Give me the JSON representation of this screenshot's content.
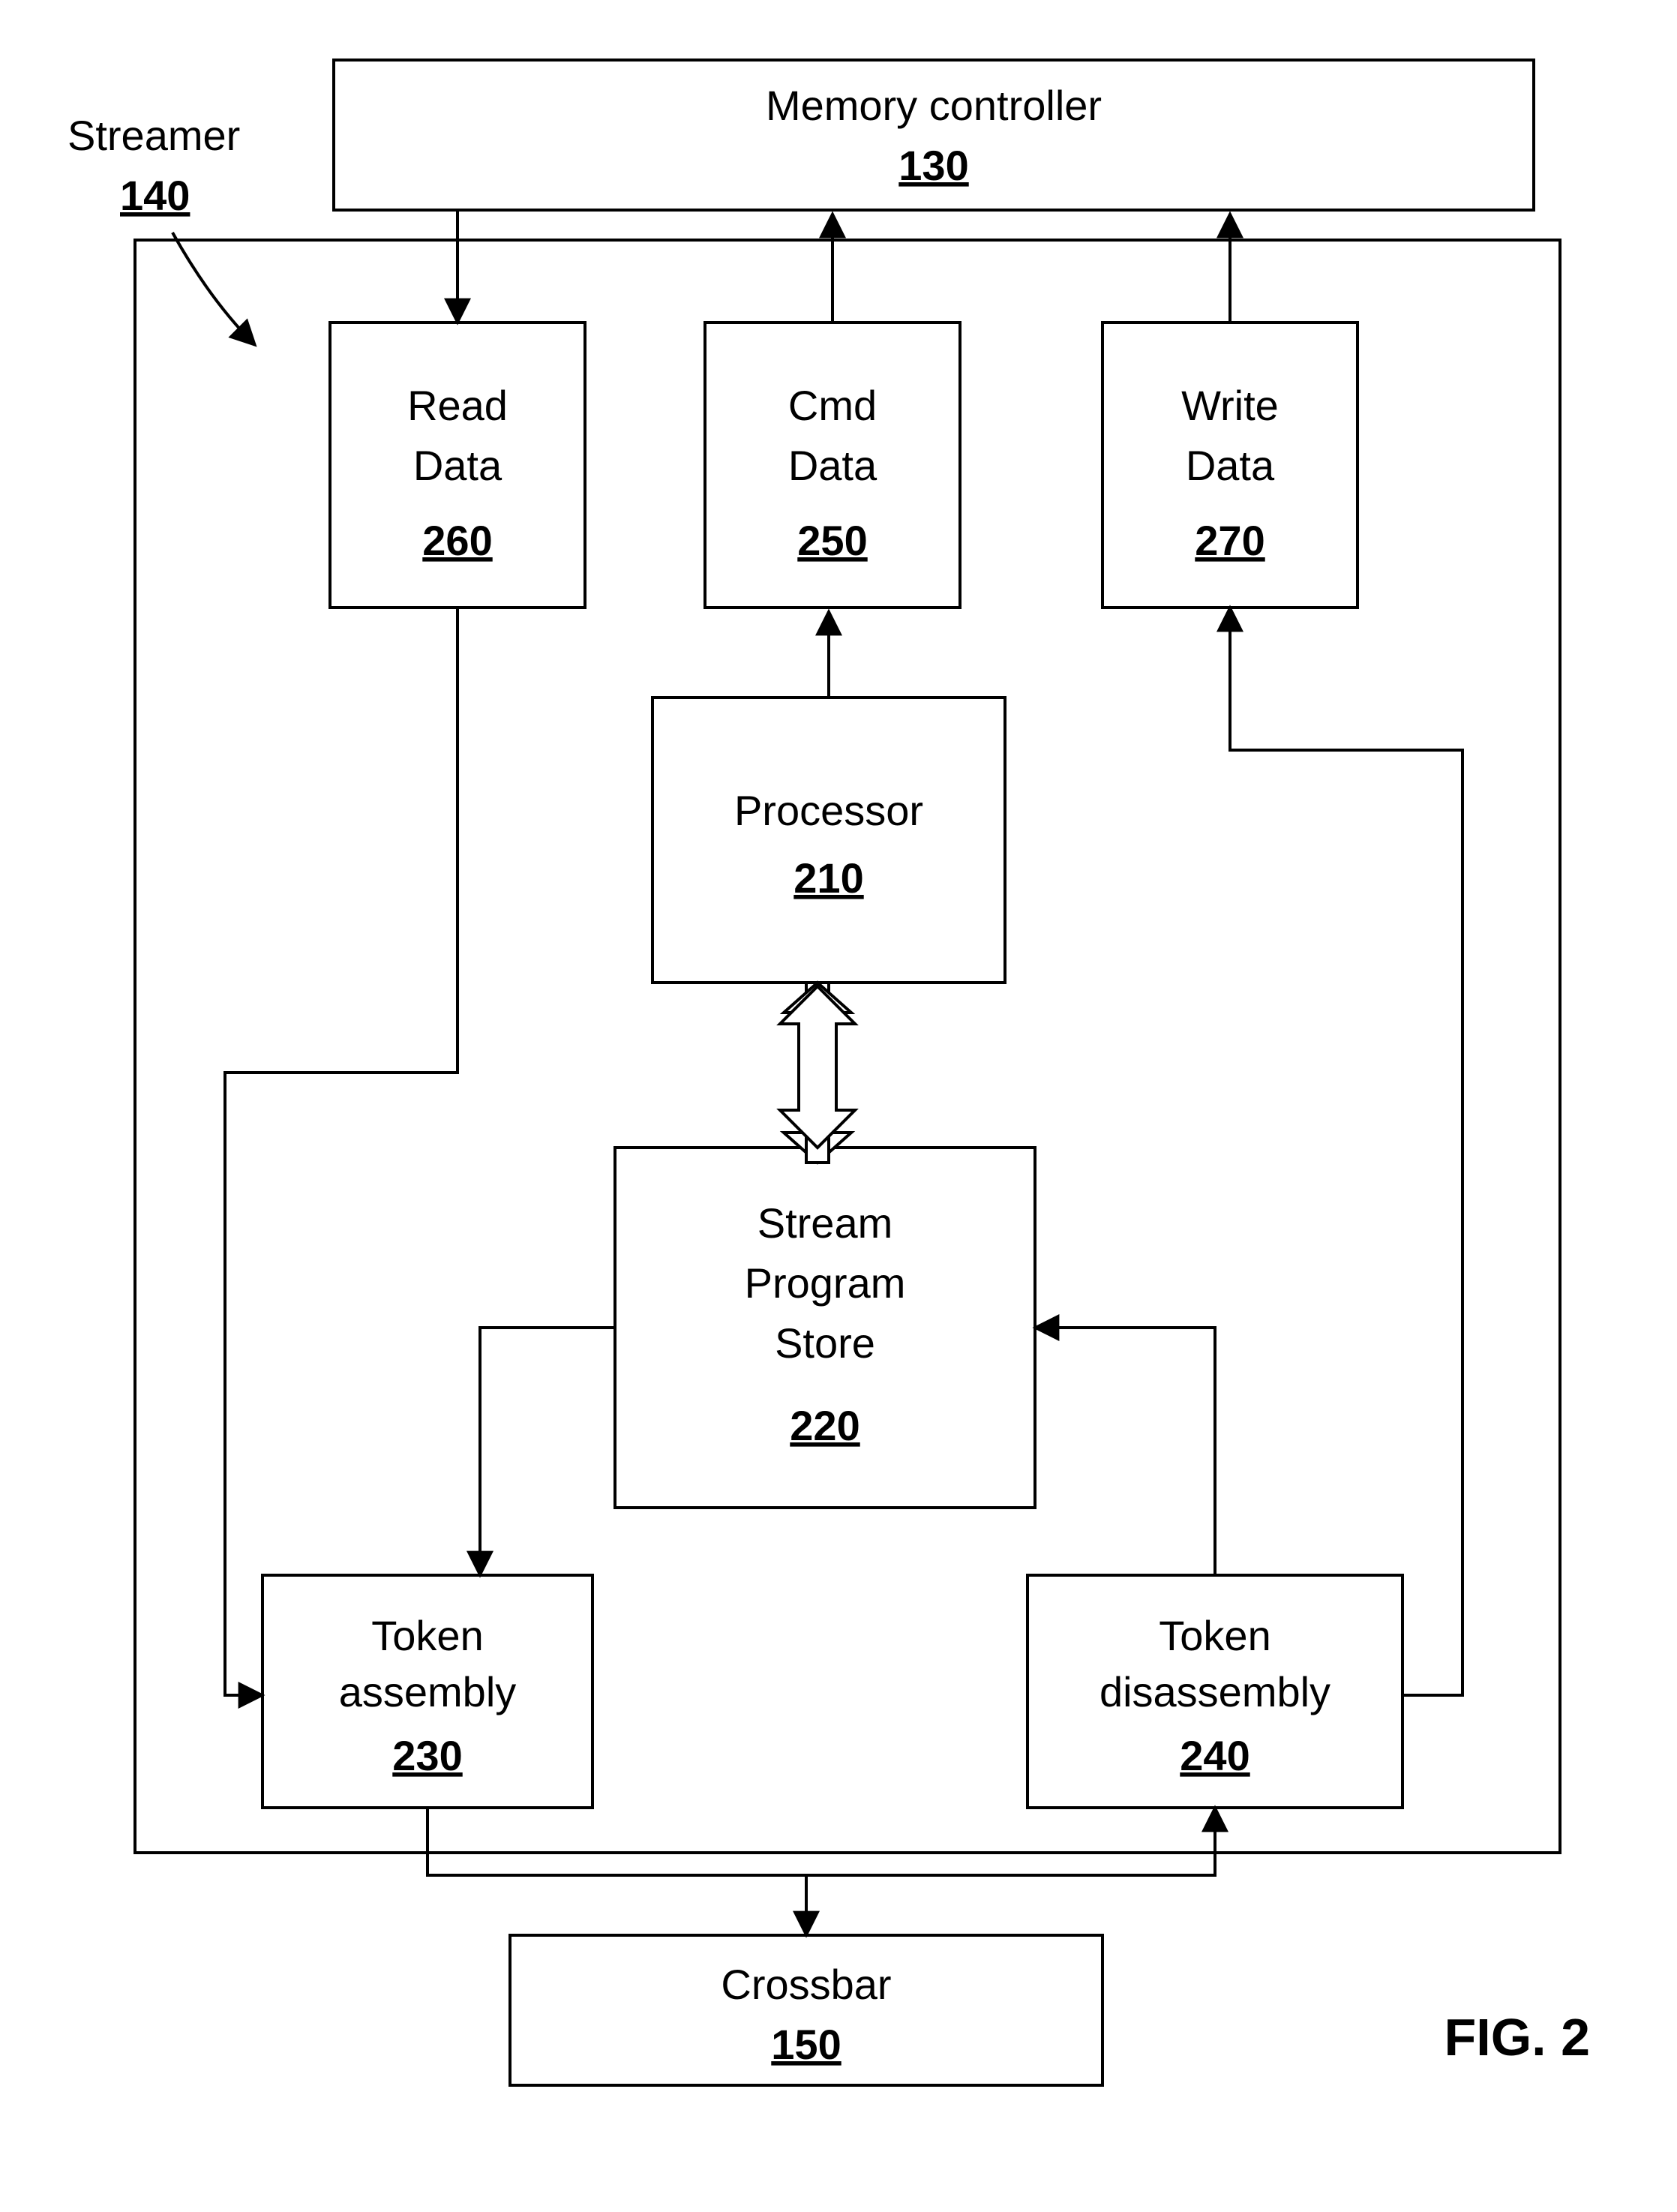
{
  "streamer": {
    "label": "Streamer",
    "num": "140"
  },
  "memctrl": {
    "label": "Memory controller",
    "num": "130"
  },
  "read": {
    "label": "Read Data",
    "num": "260",
    "l1": "Read",
    "l2": "Data"
  },
  "cmd": {
    "label": "Cmd Data",
    "num": "250",
    "l1": "Cmd",
    "l2": "Data"
  },
  "write": {
    "label": "Write Data",
    "num": "270",
    "l1": "Write",
    "l2": "Data"
  },
  "proc": {
    "label": "Processor",
    "num": "210"
  },
  "sps": {
    "label": "Stream Program Store",
    "num": "220",
    "l1": "Stream",
    "l2": "Program",
    "l3": "Store"
  },
  "tokasm": {
    "label": "Token assembly",
    "num": "230",
    "l1": "Token",
    "l2": "assembly"
  },
  "tokdis": {
    "label": "Token disassembly",
    "num": "240",
    "l1": "Token",
    "l2": "disassembly"
  },
  "crossbar": {
    "label": "Crossbar",
    "num": "150"
  },
  "figure": "FIG. 2"
}
